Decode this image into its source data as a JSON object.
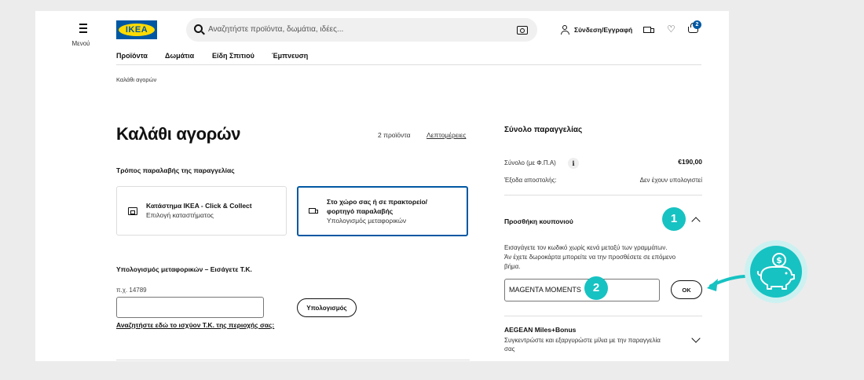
{
  "header": {
    "menu_label": "Μενού",
    "logo_text": "IKEA",
    "search_placeholder": "Αναζητήστε προϊόντα, δωμάτια, ιδέες...",
    "login_label": "Σύνδεση/Εγγραφή",
    "cart_count": "2",
    "icons": [
      "menu-icon",
      "search-icon",
      "camera-icon",
      "user-icon",
      "truck-icon",
      "heart-icon",
      "shopping-bag-icon"
    ]
  },
  "nav": [
    "Προϊόντα",
    "Δωμάτια",
    "Είδη Σπιτιού",
    "Έμπνευση"
  ],
  "breadcrumb": "Καλάθι αγορών",
  "cart": {
    "title": "Καλάθι αγορών",
    "item_count": "2 προϊόντα",
    "details_link": "Λεπτομέρειες",
    "delivery_heading": "Τρόπος παραλαβής της παραγγελίας",
    "options": [
      {
        "title": "Κατάστημα IKEA - Click & Collect",
        "subtitle": "Επιλογή καταστήματος",
        "selected": false
      },
      {
        "title_line1": "Στο χώρο σας ή σε πρακτορείο/",
        "title_line2": "φορτηγό παραλαβής",
        "subtitle": "Υπολογισμός μεταφορικών",
        "selected": true
      }
    ],
    "shipping_heading": "Υπολογισμός μεταφορικών – Εισάγετε Τ.Κ.",
    "zip_placeholder": "π.χ. 14789",
    "calc_button": "Υπολογισμός",
    "zip_link": "Αναζητήστε εδώ το ισχύον Τ.Κ. της περιοχής σας:"
  },
  "summary": {
    "title": "Σύνολο παραγγελίας",
    "total_label": "Σύνολο (με Φ.Π.Α)",
    "info_glyph": "i",
    "total_value": "€190,00",
    "shipping_label": "Έξοδα αποστολής:",
    "shipping_value": "Δεν έχουν υπολογιστεί",
    "coupon_heading": "Προσθήκη κουπονιού",
    "coupon_text_line1": "Εισαγάγετε τον κωδικό χωρίς κενά μεταξύ των γραμμάτων.",
    "coupon_text_line2": "Άν έχετε δωροκάρτα μπορείτε να την προσθέσετε σε επόμενο",
    "coupon_text_line3": "βήμα.",
    "coupon_value": "MAGENTA MOMENTS",
    "ok_button": "ΟΚ",
    "aegean_title": "AEGEAN Miles+Bonus",
    "aegean_text": "Συγκεντρώστε και εξαργυρώστε μίλια με την παραγγελία σας"
  },
  "annotations": {
    "marker1": "1",
    "marker2": "2",
    "accent_color": "#17c2c2",
    "piggy_icon": "piggy-bank-coin-icon"
  },
  "colors": {
    "brand_blue": "#0058a3",
    "brand_yellow": "#ffdb00",
    "background": "#ececec"
  }
}
